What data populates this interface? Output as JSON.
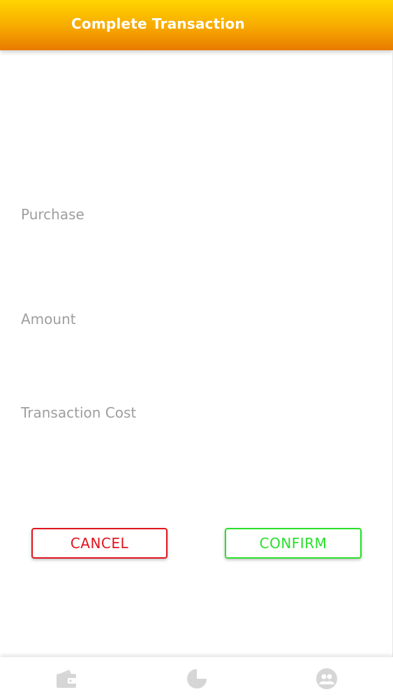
{
  "header": {
    "title": "Complete Transaction"
  },
  "form": {
    "purchase_label": "Purchase",
    "amount_label": "Amount",
    "transaction_cost_label": "Transaction Cost"
  },
  "actions": {
    "cancel_label": "CANCEL",
    "confirm_label": "CONFIRM"
  },
  "bottom_nav": {
    "items": [
      {
        "icon": "wallet-icon"
      },
      {
        "icon": "pie-chart-icon"
      },
      {
        "icon": "group-icon"
      }
    ]
  },
  "colors": {
    "header_top": "#ffd500",
    "header_bottom": "#e87a00",
    "cancel": "#e0141e",
    "confirm": "#28e028",
    "label_text": "#9e9e9e",
    "nav_icon": "#d6d6d6"
  }
}
